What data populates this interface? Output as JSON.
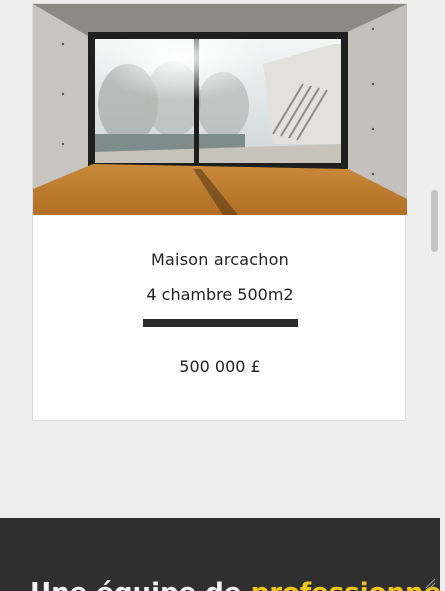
{
  "property_card": {
    "image_alt": "Modern house interior with glass wall overlooking a pool",
    "title": "Maison arcachon",
    "details": "4 chambre 500m2",
    "price": "500 000 £"
  },
  "footer": {
    "heading_part1": "Une équipe de ",
    "heading_part2": "professionnels",
    "accent_color": "#f0c419",
    "background_color": "#2f2f2f"
  },
  "colors": {
    "page_background": "#eeeeee",
    "divider": "#2b2b2b"
  }
}
